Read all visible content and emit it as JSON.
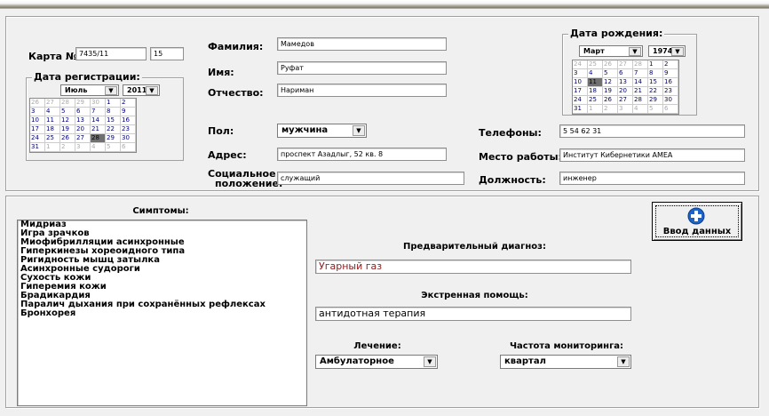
{
  "patient": {
    "card_label": "Карта №",
    "card_number": "7435/11",
    "card_suffix": "15",
    "reg_date_title": "Дата регистрации:",
    "reg_month": "Июль",
    "reg_year": "2011",
    "surname_label": "Фамилия:",
    "surname": "Мамедов",
    "name_label": "Имя:",
    "name": "Руфат",
    "patronymic_label": "Отчество:",
    "patronymic": "Нариман",
    "birth_title": "Дата рождения:",
    "birth_month": "Март",
    "birth_year": "1974",
    "gender_label": "Пол:",
    "gender": "мужчина",
    "phones_label": "Телефоны:",
    "phones": "5 54 62 31",
    "address_label": "Адрес:",
    "address": "проспект Азадлыг, 52 кв. 8",
    "workplace_label": "Место работы:",
    "workplace": "Институт Кибернетики АМЕА",
    "social_label_1": "Социальное",
    "social_label_2": "положение:",
    "social": "служащий",
    "position_label": "Должность:",
    "position": "инженер"
  },
  "reg_calendar": [
    [
      "26",
      "27",
      "28",
      "29",
      "30",
      "1",
      "2"
    ],
    [
      "3",
      "4",
      "5",
      "6",
      "7",
      "8",
      "9"
    ],
    [
      "10",
      "11",
      "12",
      "13",
      "14",
      "15",
      "16"
    ],
    [
      "17",
      "18",
      "19",
      "20",
      "21",
      "22",
      "23"
    ],
    [
      "24",
      "25",
      "26",
      "27",
      "28",
      "29",
      "30"
    ],
    [
      "31",
      "1",
      "2",
      "3",
      "4",
      "5",
      "6"
    ]
  ],
  "birth_calendar": [
    [
      "24",
      "25",
      "26",
      "27",
      "28",
      "1",
      "2"
    ],
    [
      "3",
      "4",
      "5",
      "6",
      "7",
      "8",
      "9"
    ],
    [
      "10",
      "11",
      "12",
      "13",
      "14",
      "15",
      "16"
    ],
    [
      "17",
      "18",
      "19",
      "20",
      "21",
      "22",
      "23"
    ],
    [
      "24",
      "25",
      "26",
      "27",
      "28",
      "29",
      "30"
    ],
    [
      "31",
      "1",
      "2",
      "3",
      "4",
      "5",
      "6"
    ]
  ],
  "medical": {
    "symptoms_title": "Симптомы:",
    "symptoms": [
      "Мидриаз",
      "Игра зрачков",
      "Миофибрилляции асинхронные",
      "Гиперкинезы хореоидного типа",
      "Ригидность мышц затылка",
      "Асинхронные судороги",
      "Сухость кожи",
      "Гиперемия кожи",
      "Брадикардия",
      "Паралич дыхания при сохранённых рефлексах",
      "Бронхорея"
    ],
    "diagnosis_label": "Предварительный диагноз:",
    "diagnosis": "Угарный газ",
    "emergency_label": "Экстренная помощь:",
    "emergency": "антидотная терапия",
    "treatment_label": "Лечение:",
    "treatment": "Амбулаторное",
    "monitoring_label": "Частота мониторинга:",
    "monitoring": "квартал"
  },
  "submit_button": "Ввод данных",
  "colors": {
    "diagnosis_text": "#8b1a1a",
    "calendar_day": "#00007f",
    "button_icon": "#1b63c6"
  }
}
